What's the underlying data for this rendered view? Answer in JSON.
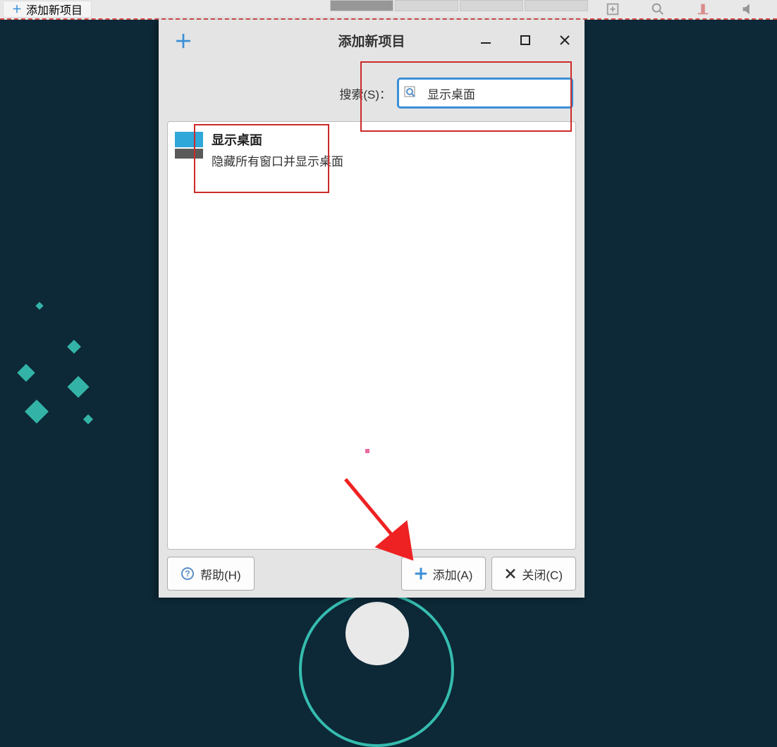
{
  "taskbar": {
    "app_label": "添加新项目"
  },
  "dialog": {
    "title": "添加新项目",
    "search_label": "搜索(S)：",
    "search_value": "显示桌面",
    "items": [
      {
        "title": "显示桌面",
        "description": "隐藏所有窗口并显示桌面"
      }
    ],
    "buttons": {
      "help": "帮助(H)",
      "add": "添加(A)",
      "close": "关闭(C)"
    }
  }
}
